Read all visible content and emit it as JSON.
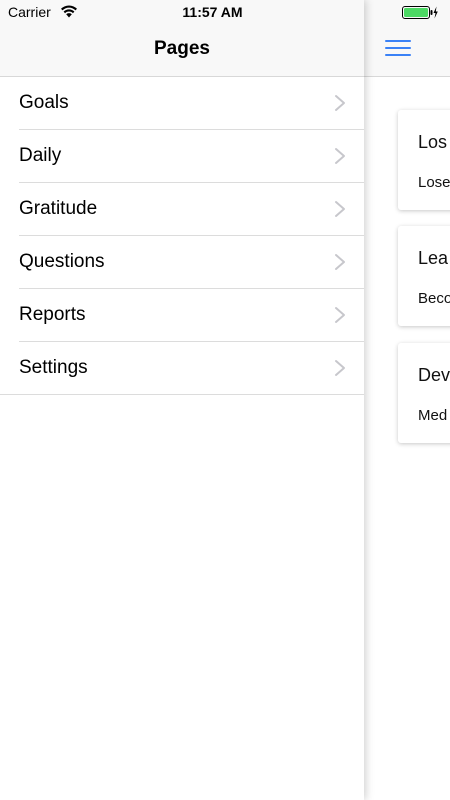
{
  "status_bar": {
    "carrier": "Carrier",
    "time": "11:57 AM"
  },
  "drawer": {
    "title": "Pages",
    "items": [
      {
        "label": "Goals"
      },
      {
        "label": "Daily"
      },
      {
        "label": "Gratitude"
      },
      {
        "label": "Questions"
      },
      {
        "label": "Reports"
      },
      {
        "label": "Settings"
      }
    ]
  },
  "main": {
    "cards": [
      {
        "title": "Los",
        "description": "Lose"
      },
      {
        "title": "Lea",
        "description": "Beco"
      },
      {
        "title": "Dev",
        "description": "Med"
      }
    ]
  },
  "colors": {
    "accent": "#3b82f6",
    "battery": "#4cd964",
    "navbar_bg": "#f8f8f8",
    "separator": "#dcdcdc"
  }
}
